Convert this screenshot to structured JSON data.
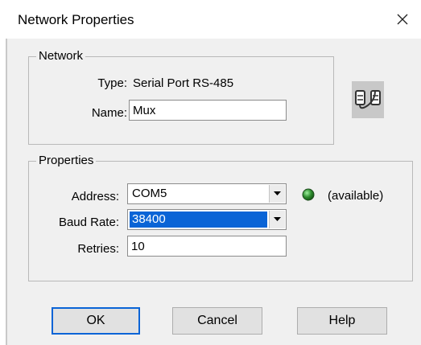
{
  "window": {
    "title": "Network Properties"
  },
  "network_group": {
    "legend": "Network",
    "type_label": "Type:",
    "type_value": "Serial Port RS-485",
    "name_label": "Name:",
    "name_value": "Mux",
    "icon": "serial-network-icon"
  },
  "properties_group": {
    "legend": "Properties",
    "address_label": "Address:",
    "address_value": "COM5",
    "address_status": "(available)",
    "status_color": "#2e8b2e",
    "baud_label": "Baud Rate:",
    "baud_value": "38400",
    "retries_label": "Retries:",
    "retries_value": "10"
  },
  "buttons": {
    "ok": "OK",
    "cancel": "Cancel",
    "help": "Help"
  },
  "colors": {
    "selection": "#0a64d6",
    "face": "#f0f0f0"
  }
}
